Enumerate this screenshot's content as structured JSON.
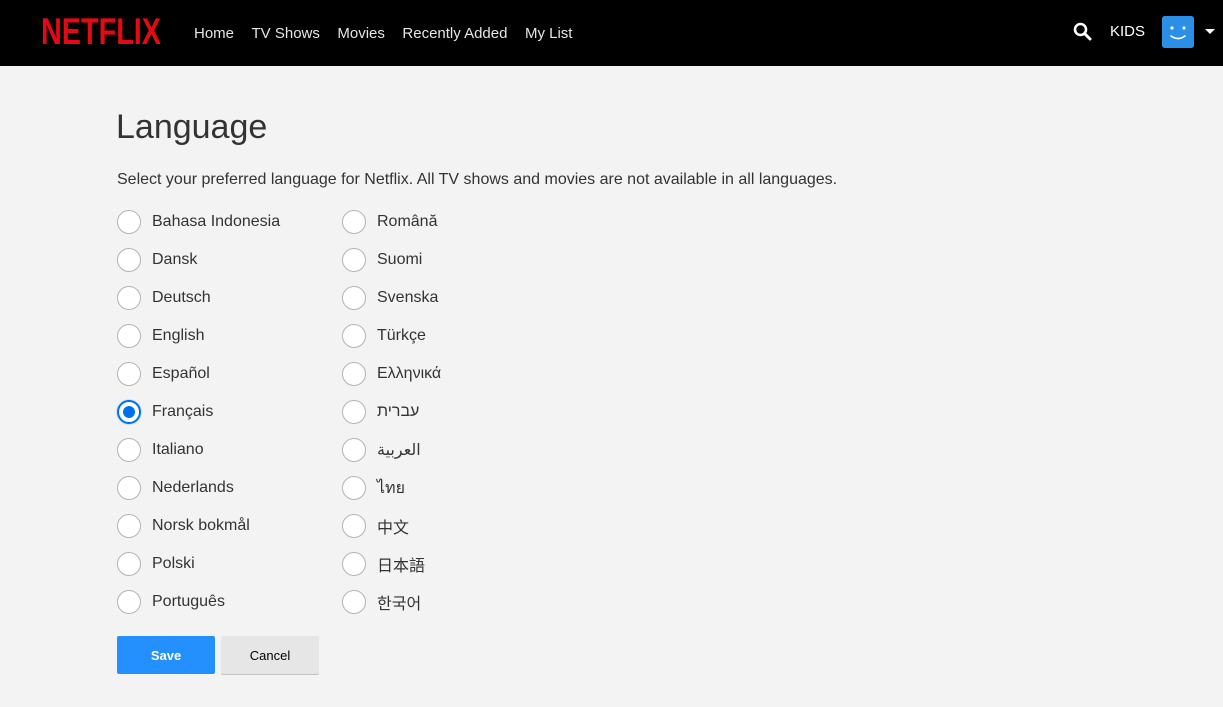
{
  "header": {
    "logo_text": "NETFLIX",
    "nav": [
      "Home",
      "TV Shows",
      "Movies",
      "Recently Added",
      "My List"
    ],
    "kids_label": "KIDS",
    "search_icon": "search-icon",
    "avatar_icon": "smiley-avatar-icon"
  },
  "colors": {
    "brand_red": "#e50914",
    "accent_blue": "#0071eb",
    "save_button": "#2490fd",
    "page_background": "#f3f3f3"
  },
  "page": {
    "title": "Language",
    "description": "Select your preferred language for Netflix. All TV shows and movies are not available in all languages.",
    "selected_language": "Français",
    "languages_left": [
      "Bahasa Indonesia",
      "Dansk",
      "Deutsch",
      "English",
      "Español",
      "Français",
      "Italiano",
      "Nederlands",
      "Norsk bokmål",
      "Polski",
      "Português"
    ],
    "languages_right": [
      "Română",
      "Suomi",
      "Svenska",
      "Türkçe",
      "Ελληνικά",
      "עברית",
      "العربية",
      "ไทย",
      "中文",
      "日本語",
      "한국어"
    ],
    "save_label": "Save",
    "cancel_label": "Cancel"
  }
}
